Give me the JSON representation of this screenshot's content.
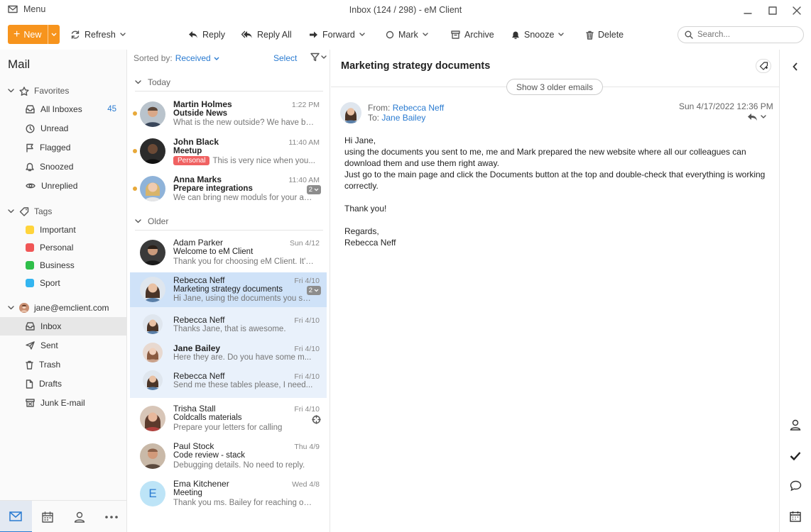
{
  "window": {
    "menu_label": "Menu",
    "title": "Inbox (124 / 298) - eM Client"
  },
  "toolbar": {
    "new_label": "New",
    "refresh_label": "Refresh",
    "reply_label": "Reply",
    "reply_all_label": "Reply All",
    "forward_label": "Forward",
    "mark_label": "Mark",
    "archive_label": "Archive",
    "snooze_label": "Snooze",
    "delete_label": "Delete",
    "search_placeholder": "Search..."
  },
  "sidebar": {
    "title": "Mail",
    "favorites_label": "Favorites",
    "favorites": [
      {
        "label": "All Inboxes",
        "count": "45"
      },
      {
        "label": "Unread"
      },
      {
        "label": "Flagged"
      },
      {
        "label": "Snoozed"
      },
      {
        "label": "Unreplied"
      }
    ],
    "tags_label": "Tags",
    "tags": [
      {
        "label": "Important",
        "color": "#ffd43b"
      },
      {
        "label": "Personal",
        "color": "#f05656"
      },
      {
        "label": "Business",
        "color": "#2fbf4a"
      },
      {
        "label": "Sport",
        "color": "#33b5f0"
      }
    ],
    "account_label": "jane@emclient.com",
    "folders": [
      {
        "label": "Inbox"
      },
      {
        "label": "Sent"
      },
      {
        "label": "Trash"
      },
      {
        "label": "Drafts"
      },
      {
        "label": "Junk E-mail"
      }
    ]
  },
  "list": {
    "sorted_by_label": "Sorted by:",
    "sort_value": "Received",
    "select_label": "Select",
    "group_today": "Today",
    "group_older": "Older",
    "messages": [
      {
        "from": "Martin Holmes",
        "date": "1:22 PM",
        "subject": "Outside News",
        "preview": "What is the new outside? We have be..."
      },
      {
        "from": "John Black",
        "date": "11:40 AM",
        "subject": "Meetup",
        "tag": "Personal",
        "preview": "This is very nice when you..."
      },
      {
        "from": "Anna Marks",
        "date": "11:40 AM",
        "subject": "Prepare integrations",
        "preview": "We can bring new moduls for your app...",
        "count": "2"
      },
      {
        "from": "Adam Parker",
        "date": "Sun 4/12",
        "subject": "Welcome to eM Client",
        "preview": "Thank you for choosing eM Client. It's..."
      },
      {
        "from": "Rebecca Neff",
        "date": "Fri 4/10",
        "subject": "Marketing strategy documents",
        "preview": "Hi Jane, using the documents you sent...",
        "count": "2"
      },
      {
        "from": "Rebecca Neff",
        "date": "Fri 4/10",
        "preview": "Thanks Jane, that is awesome."
      },
      {
        "from": "Jane Bailey",
        "date": "Fri 4/10",
        "preview": "Here they are. Do you have some m..."
      },
      {
        "from": "Rebecca Neff",
        "date": "Fri 4/10",
        "preview": "Send me these tables please, I need..."
      },
      {
        "from": "Trisha Stall",
        "date": "Fri 4/10",
        "subject": "Coldcalls materials",
        "preview": "Prepare your letters for calling"
      },
      {
        "from": "Paul Stock",
        "date": "Thu 4/9",
        "subject": "Code review - stack",
        "preview": "Debugging details. No need to reply."
      },
      {
        "from": "Ema Kitchener",
        "date": "Wed 4/8",
        "subject": "Meeting",
        "preview": "Thank you ms. Bailey for reaching out...",
        "initial": "E"
      }
    ]
  },
  "reading": {
    "subject": "Marketing strategy documents",
    "show_older": "Show 3 older emails",
    "from_label": "From:",
    "from_name": "Rebecca Neff",
    "to_label": "To:",
    "to_name": "Jane Bailey",
    "date": "Sun 4/17/2022 12:36 PM",
    "body": {
      "greeting": "Hi Jane,",
      "line1": "using the documents you sent to me, me and Mark prepared the new website where all our colleagues can download them and use them right away.",
      "line2": "Just go to the main page and click the Documents button at the top and double-check that everything is working correctly.",
      "thanks": "Thank you!",
      "regards": "Regards,",
      "signature": "Rebecca Neff"
    }
  },
  "colors": {
    "accent": "#f7941d",
    "link": "#2a7bd1",
    "selected_row": "#cfe2f8",
    "thread_row": "#e9f1fb"
  }
}
